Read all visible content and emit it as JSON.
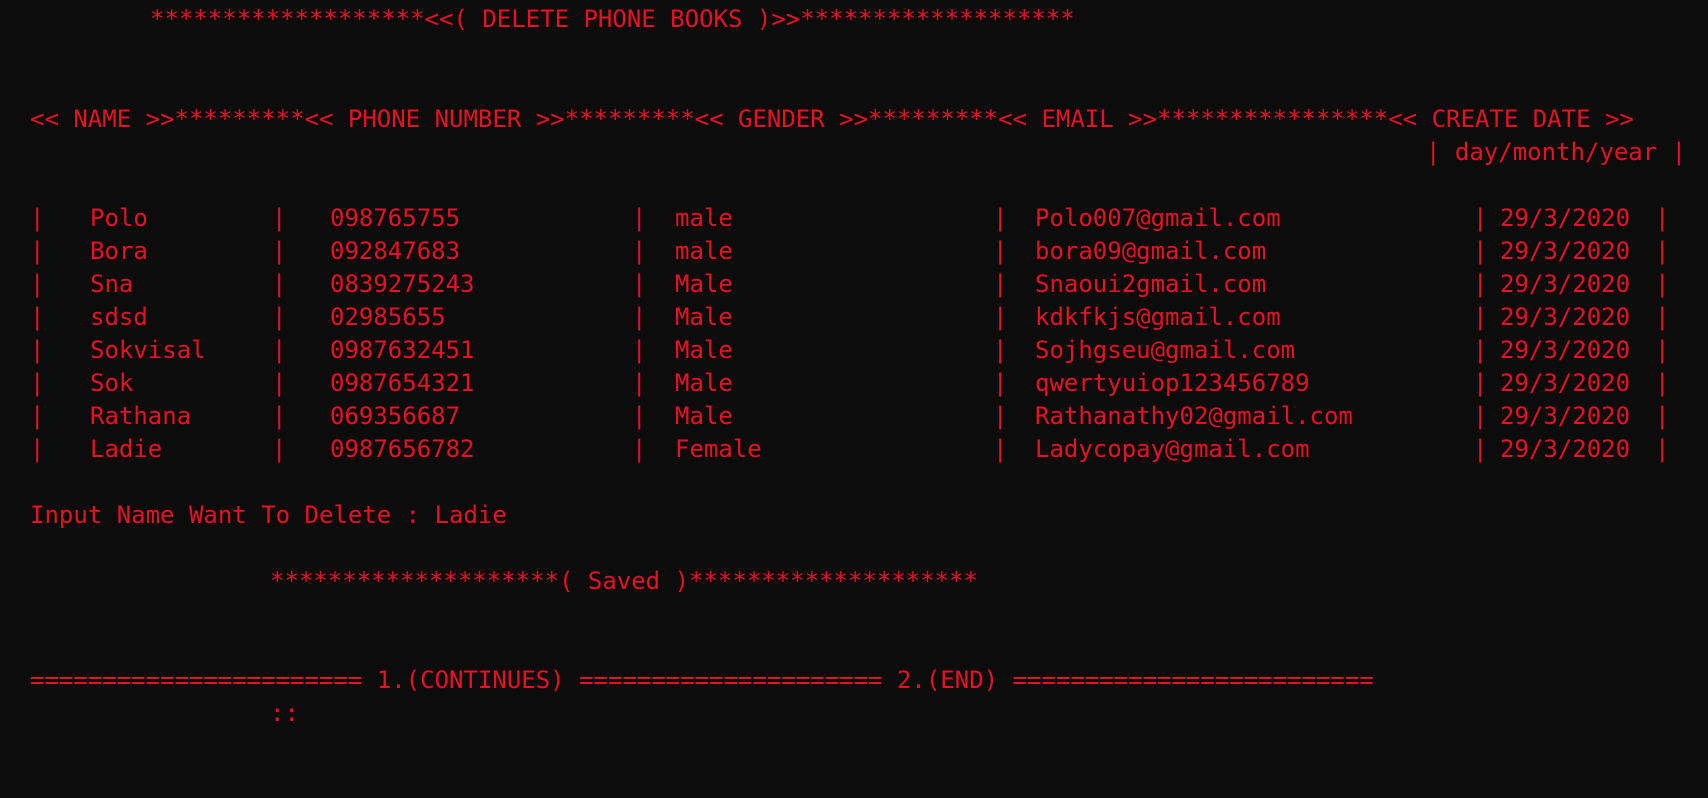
{
  "title": "*******************<<( DELETE PHONE BOOKS )>>*******************",
  "header": "<< NAME >>*********<< PHONE NUMBER >>*********<< GENDER >>*********<< EMAIL >>****************<< CREATE DATE >>",
  "date_format": "| day/month/year |",
  "rows": [
    {
      "name": "Polo",
      "phone": "098765755",
      "gender": "male",
      "email": "Polo007@gmail.com",
      "date": "29/3/2020"
    },
    {
      "name": "Bora",
      "phone": "092847683",
      "gender": "male",
      "email": "bora09@gmail.com",
      "date": "29/3/2020"
    },
    {
      "name": "Sna",
      "phone": "0839275243",
      "gender": "Male",
      "email": "Snaoui2gmail.com",
      "date": "29/3/2020"
    },
    {
      "name": "sdsd",
      "phone": "02985655",
      "gender": "Male",
      "email": "kdkfkjs@gmail.com",
      "date": "29/3/2020"
    },
    {
      "name": "Sokvisal",
      "phone": "0987632451",
      "gender": "Male",
      "email": "Sojhgseu@gmail.com",
      "date": "29/3/2020"
    },
    {
      "name": "Sok",
      "phone": "0987654321",
      "gender": "Male",
      "email": "qwertyuiop123456789",
      "date": "29/3/2020"
    },
    {
      "name": "Rathana",
      "phone": "069356687",
      "gender": "Male",
      "email": "Rathanathy02@gmail.com",
      "date": "29/3/2020"
    },
    {
      "name": "Ladie",
      "phone": "0987656782",
      "gender": "Female",
      "email": "Ladycopay@gmail.com",
      "date": "29/3/2020"
    }
  ],
  "prompt": {
    "label": "Input Name Want To Delete : ",
    "value": "Ladie"
  },
  "saved": "********************( Saved )********************",
  "menu": "======================= 1.(CONTINUES) ===================== 2.(END) =========================",
  "input_prompt": "::",
  "colors": {
    "background": "#0c0c0c",
    "text": "#e81123"
  }
}
